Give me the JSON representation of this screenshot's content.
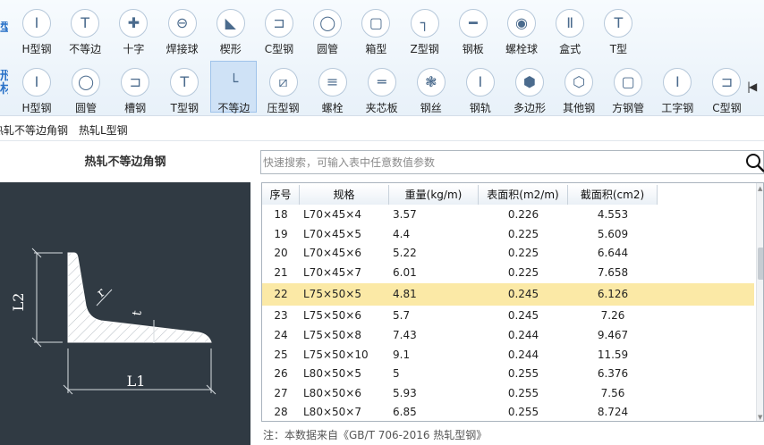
{
  "ribbon": {
    "group_tabs": [
      "型",
      "形材",
      "材"
    ],
    "row1": [
      {
        "label": "H型钢",
        "icon": "H-beam-icon",
        "glyph": "I"
      },
      {
        "label": "不等边",
        "icon": "T-icon",
        "glyph": "T"
      },
      {
        "label": "十字",
        "icon": "cross-icon",
        "glyph": "✚"
      },
      {
        "label": "焊接球",
        "icon": "weld-ball-icon",
        "glyph": "⊖"
      },
      {
        "label": "楔形",
        "icon": "wedge-icon",
        "glyph": "◣"
      },
      {
        "label": "C型钢",
        "icon": "C-channel-icon",
        "glyph": "⊐"
      },
      {
        "label": "圆管",
        "icon": "round-tube-icon",
        "glyph": "◯"
      },
      {
        "label": "箱型",
        "icon": "box-icon",
        "glyph": "▢"
      },
      {
        "label": "Z型钢",
        "icon": "Z-section-icon",
        "glyph": "┐"
      },
      {
        "label": "钢板",
        "icon": "plate-icon",
        "glyph": "━"
      },
      {
        "label": "螺栓球",
        "icon": "bolt-ball-icon",
        "glyph": "◉"
      },
      {
        "label": "盒式",
        "icon": "box-style-icon",
        "glyph": "Ⅱ"
      },
      {
        "label": "T型",
        "icon": "T-section-icon",
        "glyph": "T"
      }
    ],
    "row2": [
      {
        "label": "H型钢",
        "icon": "H-beam-icon",
        "glyph": "I"
      },
      {
        "label": "圆管",
        "icon": "round-tube-icon",
        "glyph": "◯"
      },
      {
        "label": "槽钢",
        "icon": "channel-icon",
        "glyph": "⊐"
      },
      {
        "label": "T型钢",
        "icon": "T-steel-icon",
        "glyph": "T"
      },
      {
        "label": "不等边",
        "icon": "unequal-angle-icon",
        "glyph": "└"
      },
      {
        "label": "压型钢",
        "icon": "corrugated-icon",
        "glyph": "⧄"
      },
      {
        "label": "螺栓",
        "icon": "bolt-icon",
        "glyph": "≡"
      },
      {
        "label": "夹芯板",
        "icon": "sandwich-panel-icon",
        "glyph": "═"
      },
      {
        "label": "钢丝",
        "icon": "wire-icon",
        "glyph": "❃"
      },
      {
        "label": "钢轨",
        "icon": "rail-icon",
        "glyph": "I"
      },
      {
        "label": "多边形",
        "icon": "polygon-icon",
        "glyph": "⬢"
      },
      {
        "label": "其他钢",
        "icon": "other-steel-icon",
        "glyph": "⬡"
      },
      {
        "label": "方钢管",
        "icon": "square-tube-icon",
        "glyph": "▢"
      },
      {
        "label": "工字钢",
        "icon": "I-beam-icon",
        "glyph": "I"
      },
      {
        "label": "C型钢",
        "icon": "C-steel-icon",
        "glyph": "⊐"
      }
    ],
    "selected_index_row2": 4,
    "scroll_glyph": "|◀"
  },
  "subtabs": [
    "热轧不等边角钢",
    "热轧L型钢"
  ],
  "left_panel": {
    "title": "热轧不等边角钢",
    "labels": {
      "L1": "L1",
      "L2": "L2",
      "r": "r",
      "t": "t"
    }
  },
  "search": {
    "placeholder": "快速搜索，可输入表中任意数值参数",
    "value": ""
  },
  "table": {
    "columns": [
      "序号",
      "规格",
      "重量(kg/m)",
      "表面积(m2/m)",
      "截面积(cm2)"
    ],
    "rows": [
      [
        "18",
        "L70×45×4",
        "3.57",
        "0.226",
        "4.553"
      ],
      [
        "19",
        "L70×45×5",
        "4.4",
        "0.225",
        "5.609"
      ],
      [
        "20",
        "L70×45×6",
        "5.22",
        "0.225",
        "6.644"
      ],
      [
        "21",
        "L70×45×7",
        "6.01",
        "0.225",
        "7.658"
      ],
      [
        "22",
        "L75×50×5",
        "4.81",
        "0.245",
        "6.126"
      ],
      [
        "23",
        "L75×50×6",
        "5.7",
        "0.245",
        "7.26"
      ],
      [
        "24",
        "L75×50×8",
        "7.43",
        "0.244",
        "9.467"
      ],
      [
        "25",
        "L75×50×10",
        "9.1",
        "0.244",
        "11.59"
      ],
      [
        "26",
        "L80×50×5",
        "5",
        "0.255",
        "6.376"
      ],
      [
        "27",
        "L80×50×6",
        "5.93",
        "0.255",
        "7.56"
      ],
      [
        "28",
        "L80×50×7",
        "6.85",
        "0.255",
        "8.724"
      ]
    ],
    "selected_row_index": 4
  },
  "note": "注：本数据来自《GB/T 706-2016 热轧型钢》",
  "colors": {
    "accent": "#2a72c8",
    "selection": "#fbe9a6",
    "diagram_bg": "#303a43"
  }
}
